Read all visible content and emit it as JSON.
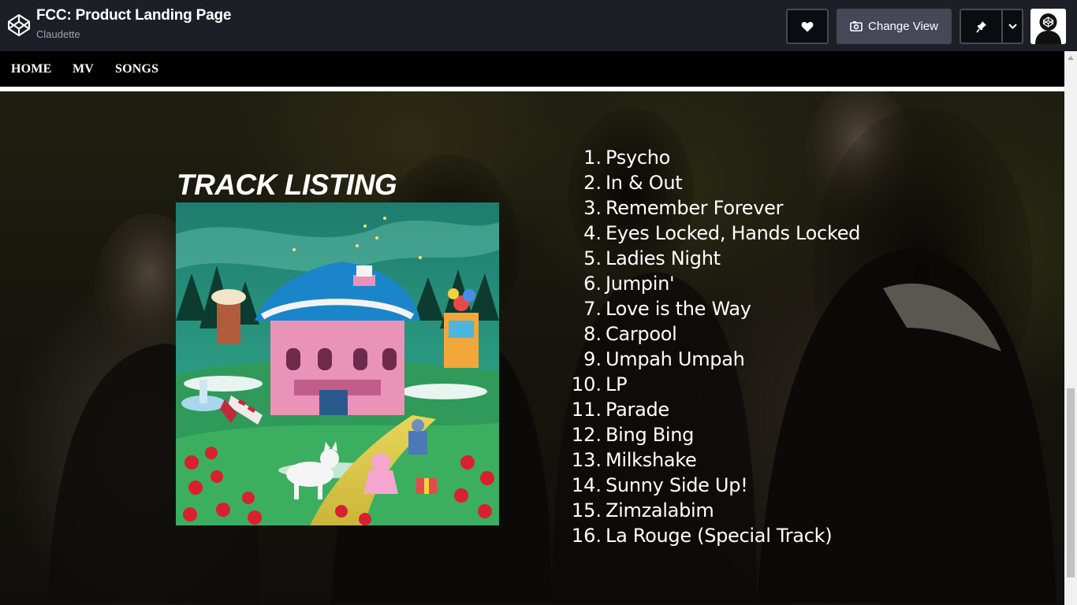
{
  "header": {
    "title": "FCC: Product Landing Page",
    "author": "Claudette",
    "change_view_label": "Change View"
  },
  "nav": {
    "items": [
      "HOME",
      "MV",
      "SONGS"
    ]
  },
  "section": {
    "heading": "TRACK LISTING"
  },
  "tracks": [
    {
      "num": "1.",
      "title": "Psycho"
    },
    {
      "num": "2.",
      "title": "In & Out"
    },
    {
      "num": "3.",
      "title": "Remember Forever"
    },
    {
      "num": "4.",
      "title": "Eyes Locked, Hands Locked"
    },
    {
      "num": "5.",
      "title": "Ladies Night"
    },
    {
      "num": "6.",
      "title": "Jumpin'"
    },
    {
      "num": "7.",
      "title": "Love is the Way"
    },
    {
      "num": "8.",
      "title": "Carpool"
    },
    {
      "num": "9.",
      "title": "Umpah Umpah"
    },
    {
      "num": "10.",
      "title": "LP"
    },
    {
      "num": "11.",
      "title": "Parade"
    },
    {
      "num": "12.",
      "title": "Bing Bing"
    },
    {
      "num": "13.",
      "title": "Milkshake"
    },
    {
      "num": "14.",
      "title": "Sunny Side Up!"
    },
    {
      "num": "15.",
      "title": "Zimzalabim"
    },
    {
      "num": "16.",
      "title": "La Rouge (Special Track)"
    }
  ],
  "colors": {
    "header_bg": "#1e1f26",
    "nav_bg": "#000000",
    "accent_button": "#444857"
  }
}
